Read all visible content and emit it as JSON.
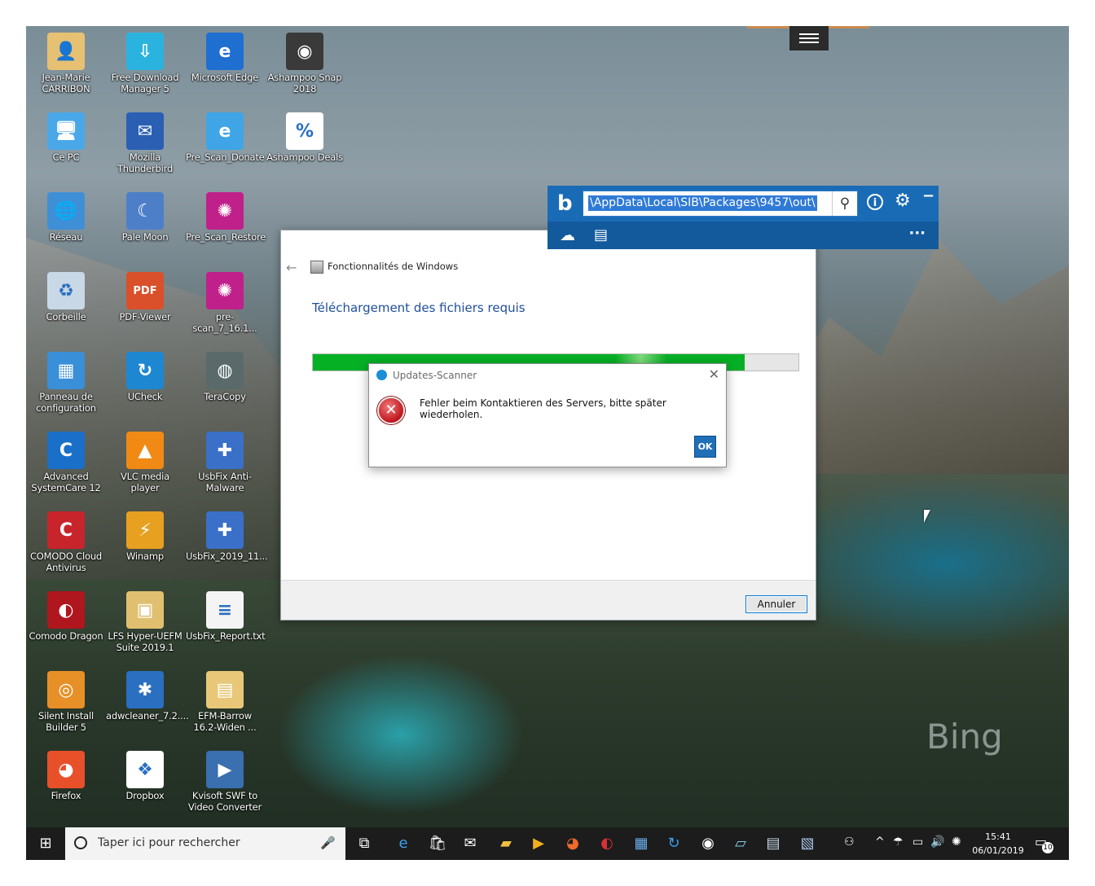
{
  "desktop": {
    "icons": [
      {
        "label": "Jean-Marie CARRIBON",
        "glyph": "👤",
        "color": "#e7c173"
      },
      {
        "label": "Free Download Manager 5",
        "glyph": "⇩",
        "color": "#2bb3e0"
      },
      {
        "label": "Microsoft Edge",
        "glyph": "e",
        "color": "#1f6fd1"
      },
      {
        "label": "Ashampoo Snap 2018",
        "glyph": "◉",
        "color": "#3a3a3a"
      },
      {
        "label": "Ce PC",
        "glyph": "🖥",
        "color": "#4aa8e8"
      },
      {
        "label": "Mozilla Thunderbird",
        "glyph": "✉",
        "color": "#2a5fb3"
      },
      {
        "label": "Pre_Scan_Donate",
        "glyph": "e",
        "color": "#3fa5e6"
      },
      {
        "label": "Ashampoo Deals",
        "glyph": "%",
        "color": "#ffffff"
      },
      {
        "label": "Réseau",
        "glyph": "🌐",
        "color": "#3f8fd6"
      },
      {
        "label": "Pale Moon",
        "glyph": "☾",
        "color": "#4d7fc9"
      },
      {
        "label": "Pre_Scan_Restore",
        "glyph": "✺",
        "color": "#c0208a"
      },
      {
        "label": "Corbeille",
        "glyph": "♻",
        "color": "#c9d8e6"
      },
      {
        "label": "PDF-Viewer",
        "glyph": "PDF",
        "color": "#d9502a"
      },
      {
        "label": "pre-scan_7_16.1...",
        "glyph": "✺",
        "color": "#c0208a"
      },
      {
        "label": "Panneau de configuration",
        "glyph": "▦",
        "color": "#3a8fd9"
      },
      {
        "label": "UCheck",
        "glyph": "↻",
        "color": "#1d88d1"
      },
      {
        "label": "TeraCopy",
        "glyph": "◍",
        "color": "#5a6a6a"
      },
      {
        "label": "Advanced SystemCare 12",
        "glyph": "C",
        "color": "#1a6fc9"
      },
      {
        "label": "VLC media player",
        "glyph": "▲",
        "color": "#f08a14"
      },
      {
        "label": "UsbFix Anti-Malware",
        "glyph": "✚",
        "color": "#3a70c8"
      },
      {
        "label": "COMODO Cloud Antivirus",
        "glyph": "C",
        "color": "#c8242c"
      },
      {
        "label": "Winamp",
        "glyph": "⚡",
        "color": "#e8a020"
      },
      {
        "label": "UsbFix_2019_11...",
        "glyph": "✚",
        "color": "#3a70c8"
      },
      {
        "label": "Comodo Dragon",
        "glyph": "◐",
        "color": "#b0161e"
      },
      {
        "label": "LFS Hyper-UEFM Suite 2019.1",
        "glyph": "▣",
        "color": "#e0c070"
      },
      {
        "label": "UsbFix_Report.txt",
        "glyph": "≡",
        "color": "#f4f4f4"
      },
      {
        "label": "Silent Install Builder 5",
        "glyph": "◎",
        "color": "#e89028"
      },
      {
        "label": "adwcleaner_7.2....",
        "glyph": "✱",
        "color": "#2a6fc0"
      },
      {
        "label": "EFM-Barrow 16.2-Widen ...",
        "glyph": "▤",
        "color": "#e8c878"
      },
      {
        "label": "Firefox",
        "glyph": "◕",
        "color": "#e8502a"
      },
      {
        "label": "Dropbox",
        "glyph": "❖",
        "color": "#ffffff"
      },
      {
        "label": "Kvisoft SWF to Video Converter",
        "glyph": "▶",
        "color": "#3a6fb0"
      }
    ]
  },
  "features_window": {
    "title": "Fonctionnalités de Windows",
    "heading": "Téléchargement des fichiers requis",
    "progress": 0.89,
    "cancel_label": "Annuler",
    "back_icon": "←"
  },
  "dialog": {
    "title": "Updates-Scanner",
    "message": "Fehler beim Kontaktieren des Servers, bitte später wiederholen.",
    "ok_label": "OK",
    "close_icon": "✕",
    "error_icon": "✕"
  },
  "bing_bar": {
    "search_value": "\\AppData\\Local\\SIB\\Packages\\9457\\out\\",
    "logo": "b",
    "search_icon": "⚲",
    "info_icon": "i",
    "gear_icon": "⚙",
    "minimize_icon": "−",
    "weather_icon": "☁",
    "news_icon": "▤",
    "more_icon": "···"
  },
  "watermark": "Bing",
  "taskbar": {
    "start_icon": "⊞",
    "search_placeholder": "Taper ici pour rechercher",
    "mic_icon": "🎤",
    "pinned": [
      {
        "name": "task-view",
        "glyph": "⧉",
        "color": "#ffffff"
      },
      {
        "name": "edge",
        "glyph": "e",
        "color": "#3a9ef0"
      },
      {
        "name": "store",
        "glyph": "🛍",
        "color": "#ffffff"
      },
      {
        "name": "mail",
        "glyph": "✉",
        "color": "#ffffff"
      },
      {
        "name": "explorer",
        "glyph": "▰",
        "color": "#f0c040"
      },
      {
        "name": "media",
        "glyph": "▶",
        "color": "#f0b020"
      },
      {
        "name": "firefox",
        "glyph": "◕",
        "color": "#f06a2a"
      },
      {
        "name": "comodo-dragon",
        "glyph": "◐",
        "color": "#d8303a"
      },
      {
        "name": "video-converter",
        "glyph": "▦",
        "color": "#6ab0f0"
      },
      {
        "name": "ucheck",
        "glyph": "↻",
        "color": "#3a9ef0"
      },
      {
        "name": "app-circle",
        "glyph": "◉",
        "color": "#ffffff"
      },
      {
        "name": "notebook",
        "glyph": "▱",
        "color": "#8ad0e8"
      },
      {
        "name": "printer",
        "glyph": "▤",
        "color": "#c8d8e8"
      },
      {
        "name": "control-panel",
        "glyph": "▧",
        "color": "#a8c8e8"
      }
    ],
    "tray": {
      "people_icon": "⚇",
      "chevron_icon": "^",
      "security_icon": "☂",
      "network_icon": "▭",
      "volume_icon": "🔊",
      "extra_icon": "✺"
    },
    "time": "15:41",
    "date": "06/01/2019",
    "notification_icon": "▭",
    "notification_count": "10"
  }
}
